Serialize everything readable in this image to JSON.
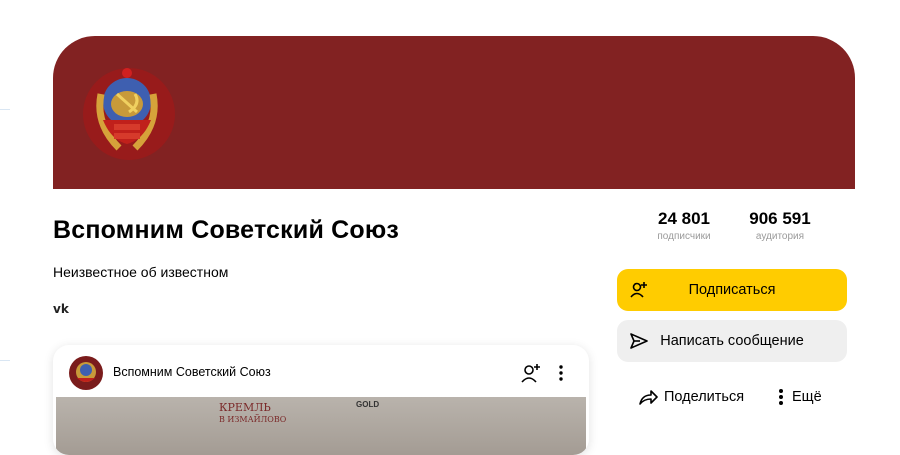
{
  "channel": {
    "title": "Вспомним Советский Союз",
    "description": "Неизвестное об известном",
    "social_label": "vk"
  },
  "stats": {
    "subscribers": {
      "value": "24 801",
      "label": "подписчики"
    },
    "audience": {
      "value": "906 591",
      "label": "аудитория"
    }
  },
  "actions": {
    "subscribe": "Подписаться",
    "message": "Написать сообщение",
    "share": "Поделиться",
    "more": "Ещё"
  },
  "post": {
    "author": "Вспомним Советский Союз",
    "image_text_1": "КРЕМЛЬ",
    "image_text_2": "В ИЗМАЙЛОВО",
    "image_logo": "GOLD"
  },
  "colors": {
    "banner": "#822222",
    "subscribe_button": "#ffcc00",
    "message_button": "#efefef"
  },
  "icons": {
    "emblem": "ussr-emblem-icon",
    "vk": "vk-icon",
    "subscribe": "add-user-icon",
    "message": "send-icon",
    "share": "share-icon",
    "more": "kebab-icon"
  }
}
